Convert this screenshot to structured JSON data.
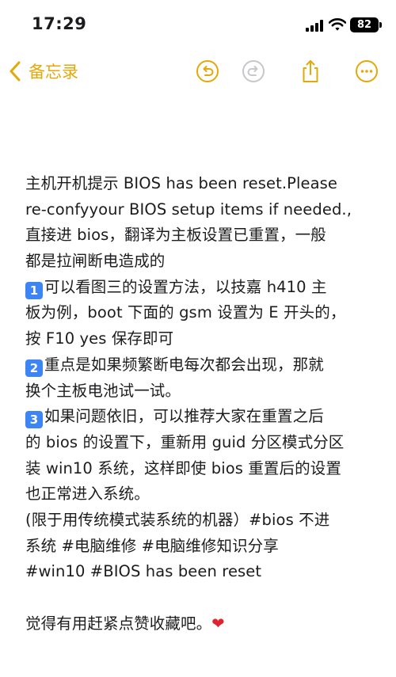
{
  "status_bar": {
    "time": "17:29",
    "battery": "82"
  },
  "toolbar": {
    "back_label": "备忘录",
    "accent_color": "#e3a90a",
    "icons": [
      "undo-icon",
      "redo-icon",
      "share-icon",
      "more-icon"
    ]
  },
  "note": {
    "lines": [
      {
        "text": "主机开机提示 BIOS has been reset.Please"
      },
      {
        "text": "re-confyyour BIOS setup items if needed.,"
      },
      {
        "text": "直接进 bios，翻译为主板设置已重置，一般"
      },
      {
        "text": "都是拉闸断电造成的"
      },
      {
        "badge": "1",
        "text": "可以看图三的设置方法，以技嘉 h410 主"
      },
      {
        "text": "板为例，boot 下面的 gsm 设置为 E 开头的，"
      },
      {
        "text": "按 F10 yes 保存即可"
      },
      {
        "badge": "2",
        "text": "重点是如果频繁断电每次都会出现，那就"
      },
      {
        "text": "换个主板电池试一试。"
      },
      {
        "badge": "3",
        "text": "如果问题依旧，可以推荐大家在重置之后"
      },
      {
        "text": "的 bios 的设置下，重新用 guid 分区模式分区"
      },
      {
        "text": "装 win10 系统，这样即使 bios 重置后的设置"
      },
      {
        "text": "也正常进入系统。"
      },
      {
        "text": "(限于用传统模式装系统的机器）#bios 不进"
      },
      {
        "text": "系统  #电脑维修  #电脑维修知识分享"
      },
      {
        "text": "#win10  #BIOS  has been reset"
      }
    ],
    "closing": "觉得有用赶紧点赞收藏吧。",
    "closing_emoji": "❤"
  }
}
